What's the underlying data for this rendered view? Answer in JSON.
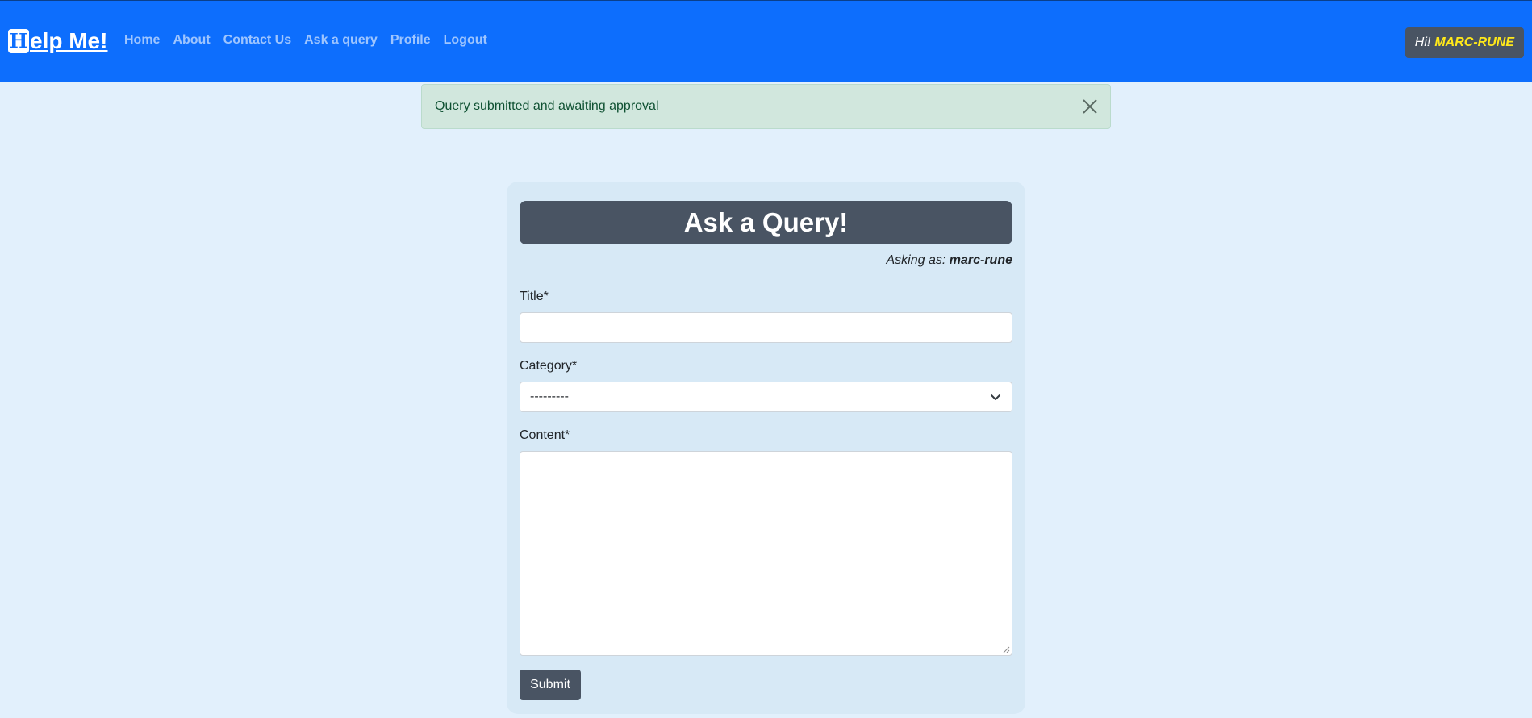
{
  "nav": {
    "brand_first_letter": "H",
    "brand_rest": "elp Me!",
    "links": [
      "Home",
      "About",
      "Contact Us",
      "Ask a query",
      "Profile",
      "Logout"
    ],
    "greeting_prefix": "Hi!",
    "greeting_user": "MARC-RUNE"
  },
  "alert": {
    "message": "Query submitted and awaiting approval",
    "close_icon": "close-icon"
  },
  "form": {
    "title": "Ask a Query!",
    "asking_prefix": "Asking as:",
    "asking_user": "marc-rune",
    "title_label": "Title*",
    "title_value": "",
    "category_label": "Category*",
    "category_selected": "---------",
    "content_label": "Content*",
    "content_value": "",
    "submit_label": "Submit"
  },
  "colors": {
    "navbar": "#0d6efd",
    "page_bg": "#e2f0fc",
    "card_bg": "#d7e9f6",
    "dark_slate": "#495463",
    "alert_bg": "#d1e7dd",
    "highlight_user": "#ffe81a"
  }
}
